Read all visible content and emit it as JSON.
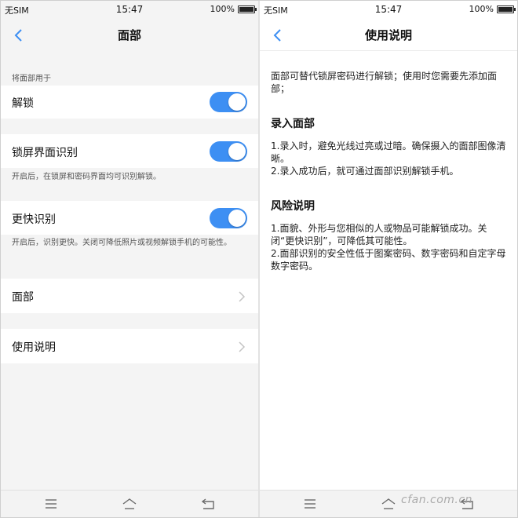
{
  "status_bar": {
    "left": {
      "carrier": "无SIM",
      "time": "15:47",
      "battery": "100%"
    },
    "right": {
      "carrier": "无SIM",
      "time": "15:47",
      "battery": "100%"
    }
  },
  "left_screen": {
    "title": "面部",
    "section_label": "将面部用于",
    "rows": [
      {
        "label": "解锁",
        "toggle_on": true
      },
      {
        "label": "锁屏界面识别",
        "toggle_on": true,
        "description": "开启后，在锁屏和密码界面均可识别解锁。"
      },
      {
        "label": "更快识别",
        "toggle_on": true,
        "description": "开启后，识别更快。关闭可降低照片或视频解锁手机的可能性。"
      }
    ],
    "links": [
      {
        "label": "面部"
      },
      {
        "label": "使用说明"
      }
    ]
  },
  "right_screen": {
    "title": "使用说明",
    "intro": "面部可替代锁屏密码进行解锁；使用时您需要先添加面部；",
    "sections": [
      {
        "heading": "录入面部",
        "lines": [
          "1.录入时，避免光线过亮或过暗。确保摄入的面部图像清晰。",
          "2.录入成功后，就可通过面部识别解锁手机。"
        ]
      },
      {
        "heading": "风险说明",
        "lines": [
          "1.面貌、外形与您相似的人或物品可能解锁成功。关闭“更快识别”，可降低其可能性。",
          "2.面部识别的安全性低于图案密码、数字密码和自定字母数字密码。"
        ]
      }
    ]
  },
  "watermark": "cfan.com.cn",
  "colors": {
    "accent": "#3d8ff3",
    "background": "#f4f4f4",
    "card": "#ffffff"
  },
  "icons": [
    "back-arrow-icon",
    "chevron-right-icon",
    "battery-icon",
    "menu-icon",
    "home-icon",
    "return-icon"
  ]
}
